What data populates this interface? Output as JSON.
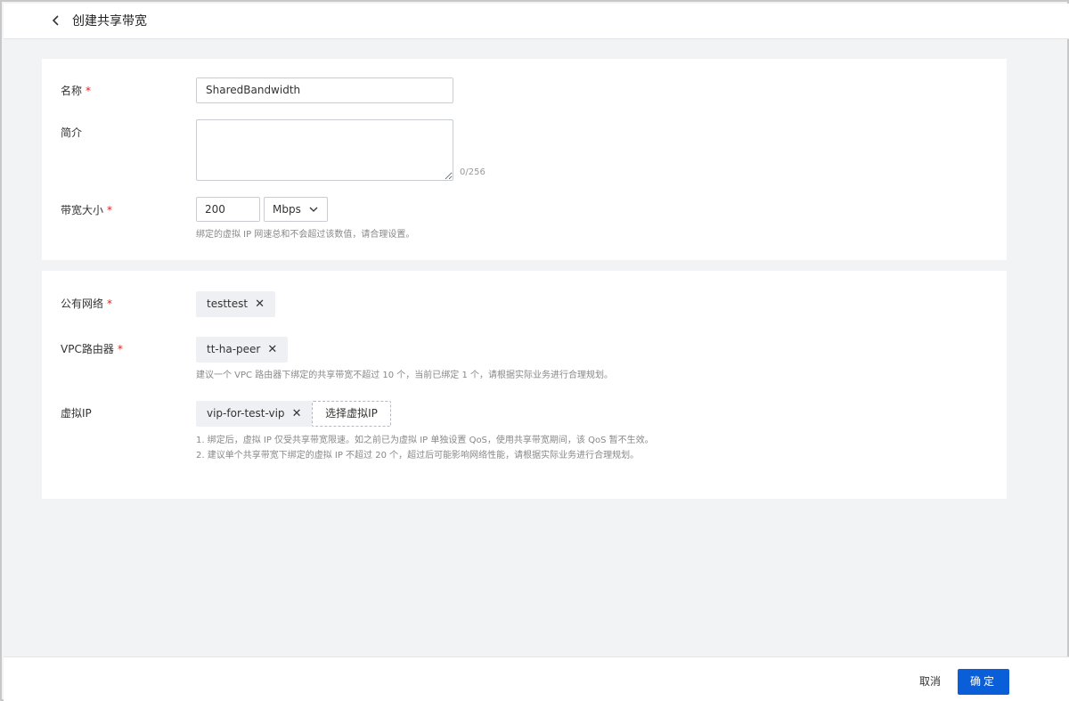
{
  "header": {
    "title": "创建共享带宽",
    "back_icon": "chevron-left-icon"
  },
  "basic": {
    "name_label": "名称",
    "name_value": "SharedBandwidth",
    "desc_label": "简介",
    "desc_value": "",
    "desc_counter": "0/256",
    "bandwidth_label": "带宽大小",
    "bandwidth_value": "200",
    "bandwidth_unit": "Mbps",
    "bandwidth_hint": "绑定的虚拟 IP 网速总和不会超过该数值，请合理设置。",
    "required_mark": "*"
  },
  "binding": {
    "network_label": "公有网络",
    "network_tags": [
      "testtest"
    ],
    "router_label": "VPC路由器",
    "router_tags": [
      "tt-ha-peer"
    ],
    "router_hint": "建议一个 VPC 路由器下绑定的共享带宽不超过 10 个，当前已绑定 1 个，请根据实际业务进行合理规划。",
    "vip_label": "虚拟IP",
    "vip_tags": [
      "vip-for-test-vip"
    ],
    "select_vip_label": "选择虚拟IP",
    "vip_hint_1": "1. 绑定后，虚拟 IP 仅受共享带宽限速。如之前已为虚拟 IP 单独设置 QoS，使用共享带宽期间，该 QoS 暂不生效。",
    "vip_hint_2": "2. 建议单个共享带宽下绑定的虚拟 IP 不超过 20 个，超过后可能影响网络性能，请根据实际业务进行合理规划。",
    "remove_icon": "close-icon"
  },
  "footer": {
    "cancel_label": "取消",
    "confirm_label": "确定"
  },
  "colors": {
    "primary": "#0a5fd8",
    "required": "#e02020",
    "tag_bg": "#eef0f3",
    "page_bg": "#f2f3f5"
  }
}
